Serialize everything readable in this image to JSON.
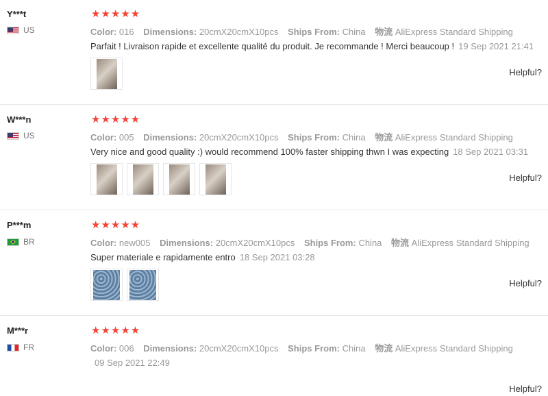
{
  "colors": {
    "star": "#f44336",
    "muted": "#999999",
    "divider": "#e8e8e8"
  },
  "labels": {
    "color": "Color:",
    "dimensions": "Dimensions:",
    "ships_from": "Ships From:",
    "logistics": "物流",
    "helpful": "Helpful?"
  },
  "reviews": [
    {
      "user": "Y***t",
      "country": "US",
      "flag": "us-flag-icon",
      "rating": 5,
      "stars": "★★★★★",
      "color": "016",
      "dimensions": "20cmX20cmX10pcs",
      "ships_from": "China",
      "shipping": "AliExpress Standard Shipping",
      "text": "Parfait ! Livraison rapide et excellente qualité du produit. Je recommande ! Merci beaucoup !",
      "date": "19 Sep 2021 21:41",
      "photos": 1
    },
    {
      "user": "W***n",
      "country": "US",
      "flag": "us-flag-icon",
      "rating": 5,
      "stars": "★★★★★",
      "color": "005",
      "dimensions": "20cmX20cmX10pcs",
      "ships_from": "China",
      "shipping": "AliExpress Standard Shipping",
      "text": "Very nice and good quality :) would recommend 100% faster shipping thwn I was expecting",
      "date": "18 Sep 2021 03:31",
      "photos": 4
    },
    {
      "user": "P***m",
      "country": "BR",
      "flag": "brazil-flag-icon",
      "rating": 5,
      "stars": "★★★★★",
      "color": "new005",
      "dimensions": "20cmX20cmX10pcs",
      "ships_from": "China",
      "shipping": "AliExpress Standard Shipping",
      "text": "Super materiale e rapidamente entro",
      "date": "18 Sep 2021 03:28",
      "photos": 2
    },
    {
      "user": "M***r",
      "country": "FR",
      "flag": "france-flag-icon",
      "rating": 5,
      "stars": "★★★★★",
      "color": "006",
      "dimensions": "20cmX20cmX10pcs",
      "ships_from": "China",
      "shipping": "AliExpress Standard Shipping",
      "text": "",
      "date": "09 Sep 2021 22:49",
      "photos": 0
    }
  ]
}
